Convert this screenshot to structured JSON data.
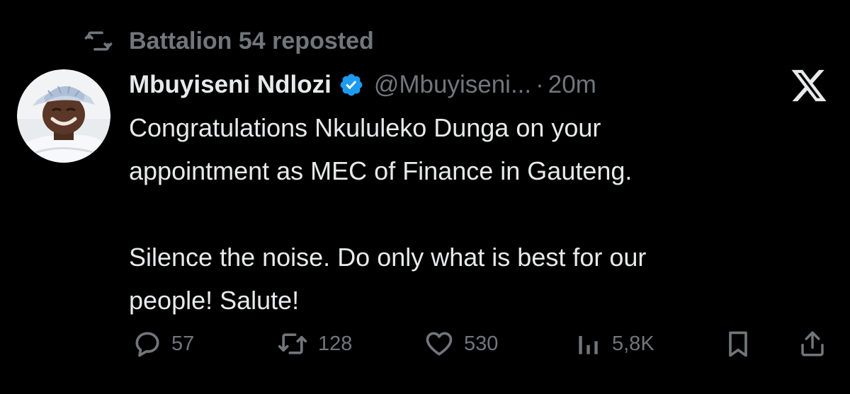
{
  "social_context": {
    "text": "Battalion 54 reposted",
    "icon": "repost-icon"
  },
  "author": {
    "display_name": "Mbuyiseni Ndlozi",
    "verified": true,
    "handle": "@Mbuyiseni...",
    "separator": "·",
    "time": "20m",
    "avatar_icon": "avatar-photo"
  },
  "tweet": {
    "lines": [
      "Congratulations Nkululeko Dunga on your",
      "appointment as MEC of Finance in Gauteng.",
      "",
      "Silence the noise. Do only what is best for our",
      "people! Salute!"
    ]
  },
  "actions": {
    "reply": {
      "icon": "reply-icon",
      "count": "57"
    },
    "repost": {
      "icon": "repost-icon",
      "count": "128"
    },
    "like": {
      "icon": "heart-icon",
      "count": "530"
    },
    "views": {
      "icon": "views-icon",
      "count": "5,8K"
    },
    "bookmark": {
      "icon": "bookmark-icon"
    },
    "share": {
      "icon": "share-icon"
    }
  },
  "brand": {
    "logo": "x-logo",
    "verified_color": "#1d9bf0",
    "secondary_text_color": "#71767b",
    "primary_text_color": "#e7e9ea",
    "background": "#000000"
  }
}
